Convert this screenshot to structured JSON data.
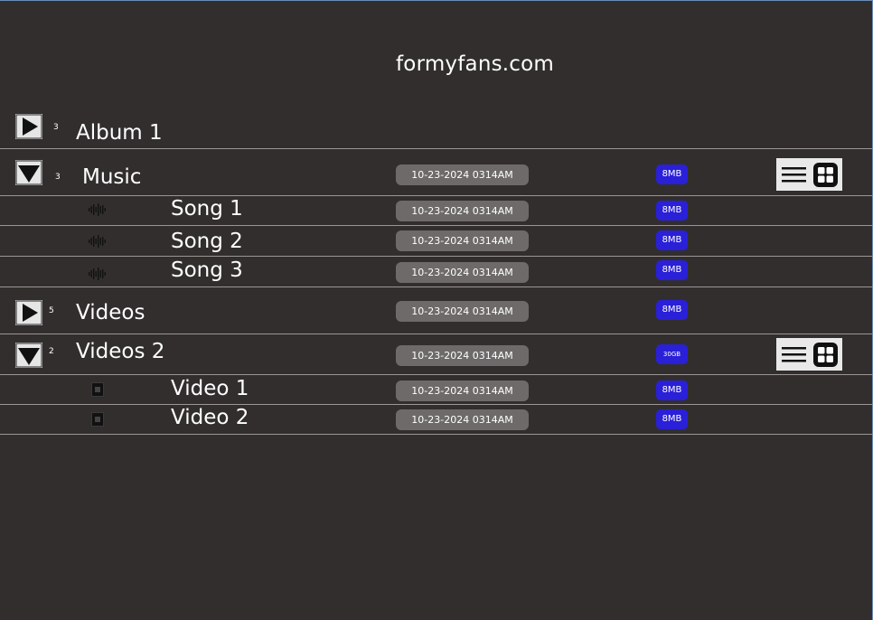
{
  "site": {
    "title": "formyfans.com"
  },
  "rows": [
    {
      "name": "Album 1",
      "count": "3",
      "expanded": false
    },
    {
      "name": "Music",
      "count": "3",
      "expanded": true,
      "date": "10-23-2024 0314AM",
      "size": "8MB"
    },
    {
      "name": "Song 1",
      "icon": "audio-wave-icon",
      "date": "10-23-2024 0314AM",
      "size": "8MB"
    },
    {
      "name": "Song 2",
      "icon": "audio-wave-icon",
      "date": "10-23-2024 0314AM",
      "size": "8MB"
    },
    {
      "name": "Song 3",
      "icon": "audio-wave-icon",
      "date": "10-23-2024 0314AM",
      "size": "8MB"
    },
    {
      "name": "Videos",
      "count": "5",
      "expanded": false,
      "date": "10-23-2024 0314AM",
      "size": "8MB"
    },
    {
      "name": "Videos 2",
      "count": "2",
      "expanded": true,
      "date": "10-23-2024 0314AM",
      "size": "30GB"
    },
    {
      "name": "Video 1",
      "icon": "video-file-icon",
      "date": "10-23-2024 0314AM",
      "size": "8MB"
    },
    {
      "name": "Video 2",
      "icon": "video-file-icon",
      "date": "10-23-2024 0314AM",
      "size": "8MB"
    }
  ],
  "colors": {
    "background": "#322e2e",
    "date_pill": "#6e6a6a",
    "size_badge": "#2a20d8",
    "divider": "#9a9696",
    "control_bg": "#e6e6e6"
  }
}
